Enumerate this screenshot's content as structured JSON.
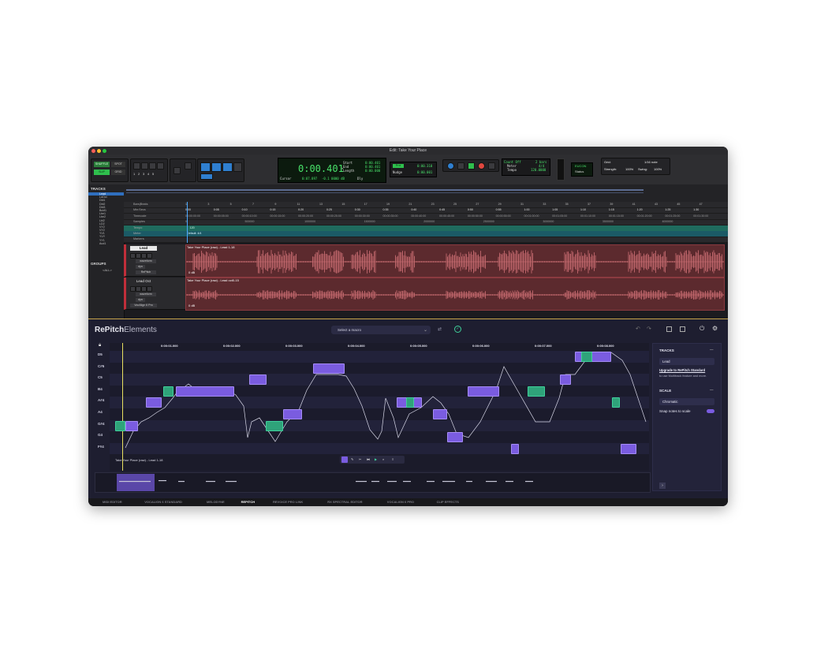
{
  "window": {
    "title": "Edit: Take Your Place"
  },
  "toolbar": {
    "mode_shuffle": "SHUFFLE",
    "mode_slip": "SLIP",
    "mode_spot": "SPOT",
    "mode_grid": "GRID",
    "track_nums": [
      "1",
      "2",
      "3",
      "4",
      "5"
    ],
    "main_counter": "0:00.401",
    "counter_unit": "▾",
    "start_label": "Start",
    "end_label": "End",
    "length_label": "Length",
    "start_val": "0:00.401",
    "end_val": "0:00.401",
    "length_val": "0:00.000",
    "cursor_label": "Cursor",
    "cursor_val": "0:07.897",
    "cursor_db": "-0.1 0000 dB",
    "dly_label": "Dly",
    "pre_label": "Pre",
    "pre_val": "0:00.310",
    "nudge_label": "Nudge",
    "nudge_val": "0:00.001",
    "count_off": "Count Off",
    "meter_label": "Meter",
    "tempo_label": "Tempo",
    "bars_val": "2 bars",
    "meter_val": "4/4",
    "tempo_val": "120.0000",
    "eucon": "EUCON",
    "status": "Status",
    "grid_label": "Grid:",
    "grid_val": "1/16 note",
    "strength_label": "Strength:",
    "strength_val": "100%",
    "swing_label": "Swing:",
    "swing_val": "100%"
  },
  "left_panel": {
    "tracks_title": "TRACKS",
    "tracks": [
      "Lead",
      "LdOct",
      "Dbl1",
      "Dbl2",
      "Dbl3",
      "Bckf1",
      "Lbe1",
      "Lbe2",
      "Lbl2",
      "LD2",
      "VY2",
      "VY2",
      "YV1",
      "YVY",
      "YY1",
      "Aud1"
    ],
    "groups_title": "GROUPS",
    "groups_item": "<ALL>"
  },
  "rulers": {
    "labels": [
      "Bars|Beats",
      "Min:Secs",
      "Timecode",
      "Samples",
      "Tempo",
      "Meter",
      "Markers"
    ],
    "bars": [
      "1",
      "3",
      "5",
      "7",
      "9",
      "11",
      "13",
      "15",
      "17",
      "19",
      "21",
      "23",
      "25",
      "27",
      "29",
      "31",
      "33",
      "35",
      "37",
      "39",
      "41",
      "43",
      "45",
      "47"
    ],
    "minsecs": [
      "0:00",
      "0:05",
      "0:10",
      "0:15",
      "0:20",
      "0:25",
      "0:30",
      "0:35",
      "0:40",
      "0:45",
      "0:50",
      "0:55",
      "1:00",
      "1:05",
      "1:10",
      "1:15",
      "1:20",
      "1:25",
      "1:30"
    ],
    "timecode": [
      "00:00:00:00",
      "00:00:05:00",
      "00:00:10:00",
      "00:00:15:00",
      "00:00:20:00",
      "00:00:25:00",
      "00:00:30:00",
      "00:00:35:00",
      "00:00:40:00",
      "00:00:45:00",
      "00:00:50:00",
      "00:00:55:00",
      "00:01:00:00",
      "00:01:05:00",
      "00:01:10:00",
      "00:01:15:00",
      "00:01:20:00",
      "00:01:25:00",
      "00:01:30:00"
    ],
    "samples": [
      "0",
      "500000",
      "1000000",
      "1500000",
      "2000000",
      "2500000",
      "3000000",
      "3500000",
      "4000000"
    ],
    "tempo_val": "♩120",
    "meter_val": "Default: 4/4"
  },
  "tracks": [
    {
      "name": "Lead",
      "view": "waveform",
      "dyn": "dyn",
      "plugin": "RePitch",
      "clip": "Take Your Place (raw) - Lead 1-18",
      "gain": "0 dB"
    },
    {
      "name": "Lead Oct",
      "view": "waveform",
      "dyn": "dyn",
      "plugin": "VocAlign 6 Pro",
      "clip": "Take Your Place (raw) - Lead oct0-15",
      "gain": "0 dB"
    }
  ],
  "repitch": {
    "brand": "RePitch",
    "brand_sub": "Elements",
    "macro_placeholder": "Select a macro",
    "ruler": [
      "0:00:01.000",
      "0:00:02.000",
      "0:00:03.000",
      "0:00:04.000",
      "0:00:05.000",
      "0:00:06.000",
      "0:00:07.000",
      "0:00:08.000"
    ],
    "keys": [
      "D5",
      "C#5",
      "C5",
      "B4",
      "A#4",
      "A4",
      "G#4",
      "G4",
      "F#4"
    ],
    "clip_label": "Take Your Place (raw) - Lead 1-18",
    "sidebar": {
      "tracks_title": "TRACKS",
      "track_value": "Lead",
      "upgrade_link": "Upgrade to RePitch Standard",
      "upgrade_note": "to use Multitrack feature and more.",
      "scale_title": "SCALE",
      "scale_value": "Chromatic",
      "snap_label": "Snap notes to scale"
    }
  },
  "bottom_tabs": [
    "MIDI EDITOR",
    "VOCALIGN 6 STANDARD",
    "MELODYNE",
    "REPITCH",
    "REVOICE PRO LINK",
    "RX SPECTRAL EDITOR",
    "VOCALIGN 6 PRO",
    "CLIP EFFECTS"
  ],
  "active_tab": "REPITCH",
  "colors": {
    "accent_green": "#49e26a",
    "note_purple": "#7a5ce0",
    "note_green": "#2fa37a",
    "waveform_red": "#e07a80",
    "repitch_bg": "#1e1e30"
  }
}
